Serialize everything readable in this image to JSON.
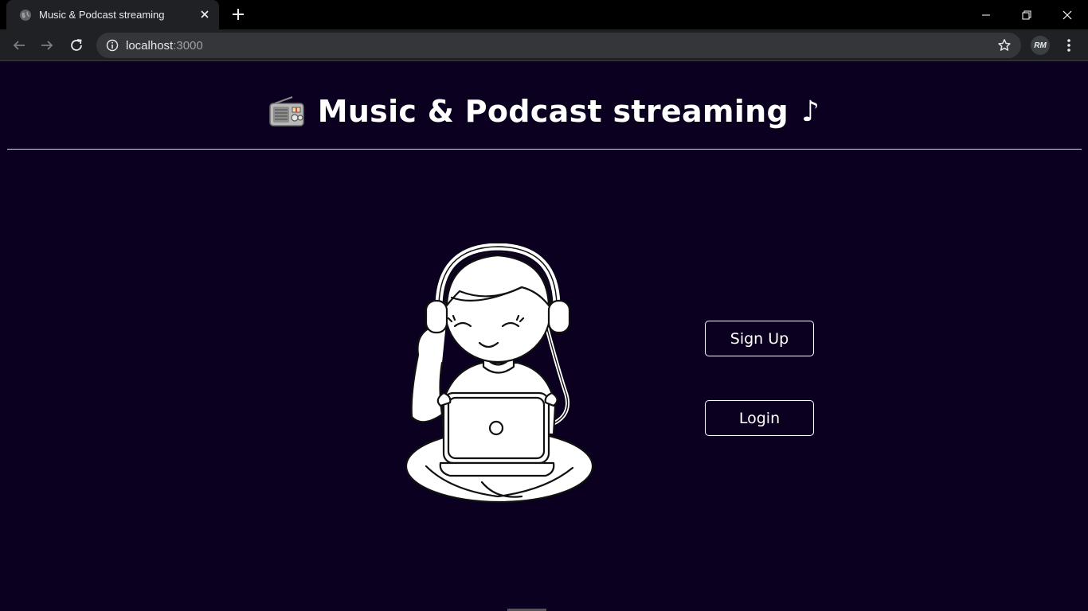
{
  "browser": {
    "tab_title": "Music & Podcast streaming",
    "url_host": "localhost",
    "url_port": ":3000",
    "profile_initials": "RM"
  },
  "page": {
    "title": "Music & Podcast streaming",
    "title_emoji": "📻",
    "title_suffix": "♪"
  },
  "buttons": {
    "signup": "Sign Up",
    "login": "Login"
  },
  "colors": {
    "background": "#0b0020",
    "accent": "#ffffff"
  }
}
